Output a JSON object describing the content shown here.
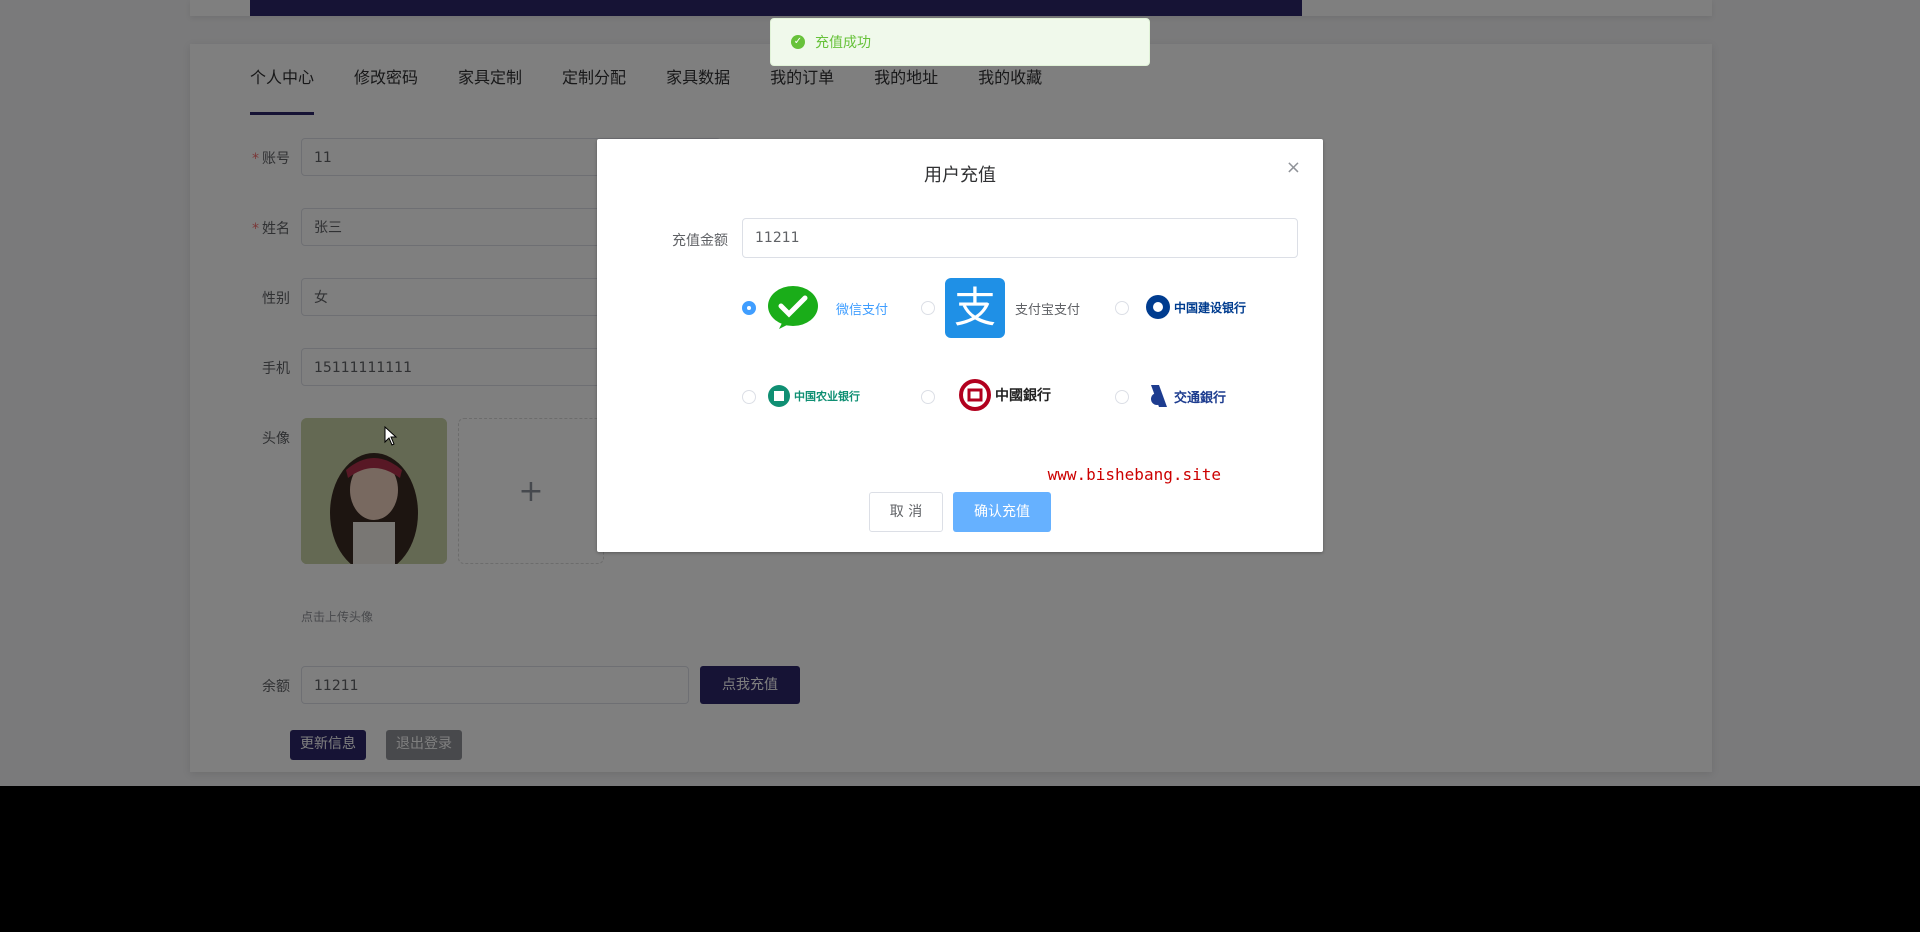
{
  "tabs": [
    "个人中心",
    "修改密码",
    "家具定制",
    "定制分配",
    "家具数据",
    "我的订单",
    "我的地址",
    "我的收藏"
  ],
  "form": {
    "account_label": "账号",
    "account_value": "11",
    "name_label": "姓名",
    "name_value": "张三",
    "gender_label": "性别",
    "gender_value": "女",
    "phone_label": "手机",
    "phone_value": "15111111111",
    "avatar_label": "头像",
    "upload_hint": "点击上传头像",
    "balance_label": "余额",
    "balance_value": "11211",
    "recharge_button": "点我充值",
    "update_button": "更新信息",
    "logout_button": "退出登录",
    "required_mark": "*",
    "upload_plus": "+"
  },
  "toast": {
    "message": "充值成功"
  },
  "dialog": {
    "title": "用户充值",
    "amount_label": "充值金额",
    "amount_value": "11211",
    "payment_options": [
      {
        "label": "微信支付",
        "selected": true
      },
      {
        "label": "支付宝支付",
        "selected": false
      },
      {
        "label": "中国建设银行",
        "selected": false
      },
      {
        "label": "中国农业银行",
        "selected": false
      },
      {
        "label": "中國銀行",
        "selected": false
      },
      {
        "label": "交通銀行",
        "selected": false
      }
    ],
    "watermark": "www.bishebang.site",
    "cancel_button": "取 消",
    "confirm_button": "确认充值",
    "close_glyph": "×"
  },
  "colors": {
    "primary": "#2d266b",
    "accent": "#409eff",
    "success": "#67c23a"
  }
}
